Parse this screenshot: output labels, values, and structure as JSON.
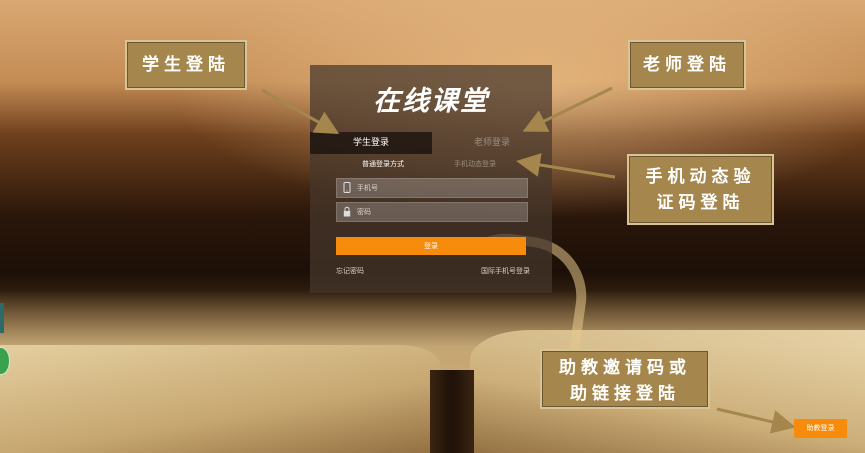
{
  "panel": {
    "title": "在线课堂",
    "tabs": {
      "student": "学生登录",
      "teacher": "老师登录"
    },
    "modes": {
      "normal": "普通登录方式",
      "sms": "手机动态登录"
    },
    "fields": {
      "phone_placeholder": "手机号",
      "phone_icon": "phone-icon",
      "password_placeholder": "密码",
      "password_icon": "lock-icon"
    },
    "login_button": "登录",
    "links": {
      "forgot": "忘记密码",
      "international": "国际手机号登录"
    }
  },
  "callouts": {
    "student": "学生登陆",
    "teacher": "老师登陆",
    "sms_line1": "手机动态验",
    "sms_line2": "证码登陆",
    "assistant_line1": "助教邀请码或",
    "assistant_line2": "助链接登陆"
  },
  "assistant_button": "助教登录",
  "colors": {
    "accent": "#f68b0c",
    "callout_bg": "#a5874d",
    "callout_border": "#d8c596"
  }
}
